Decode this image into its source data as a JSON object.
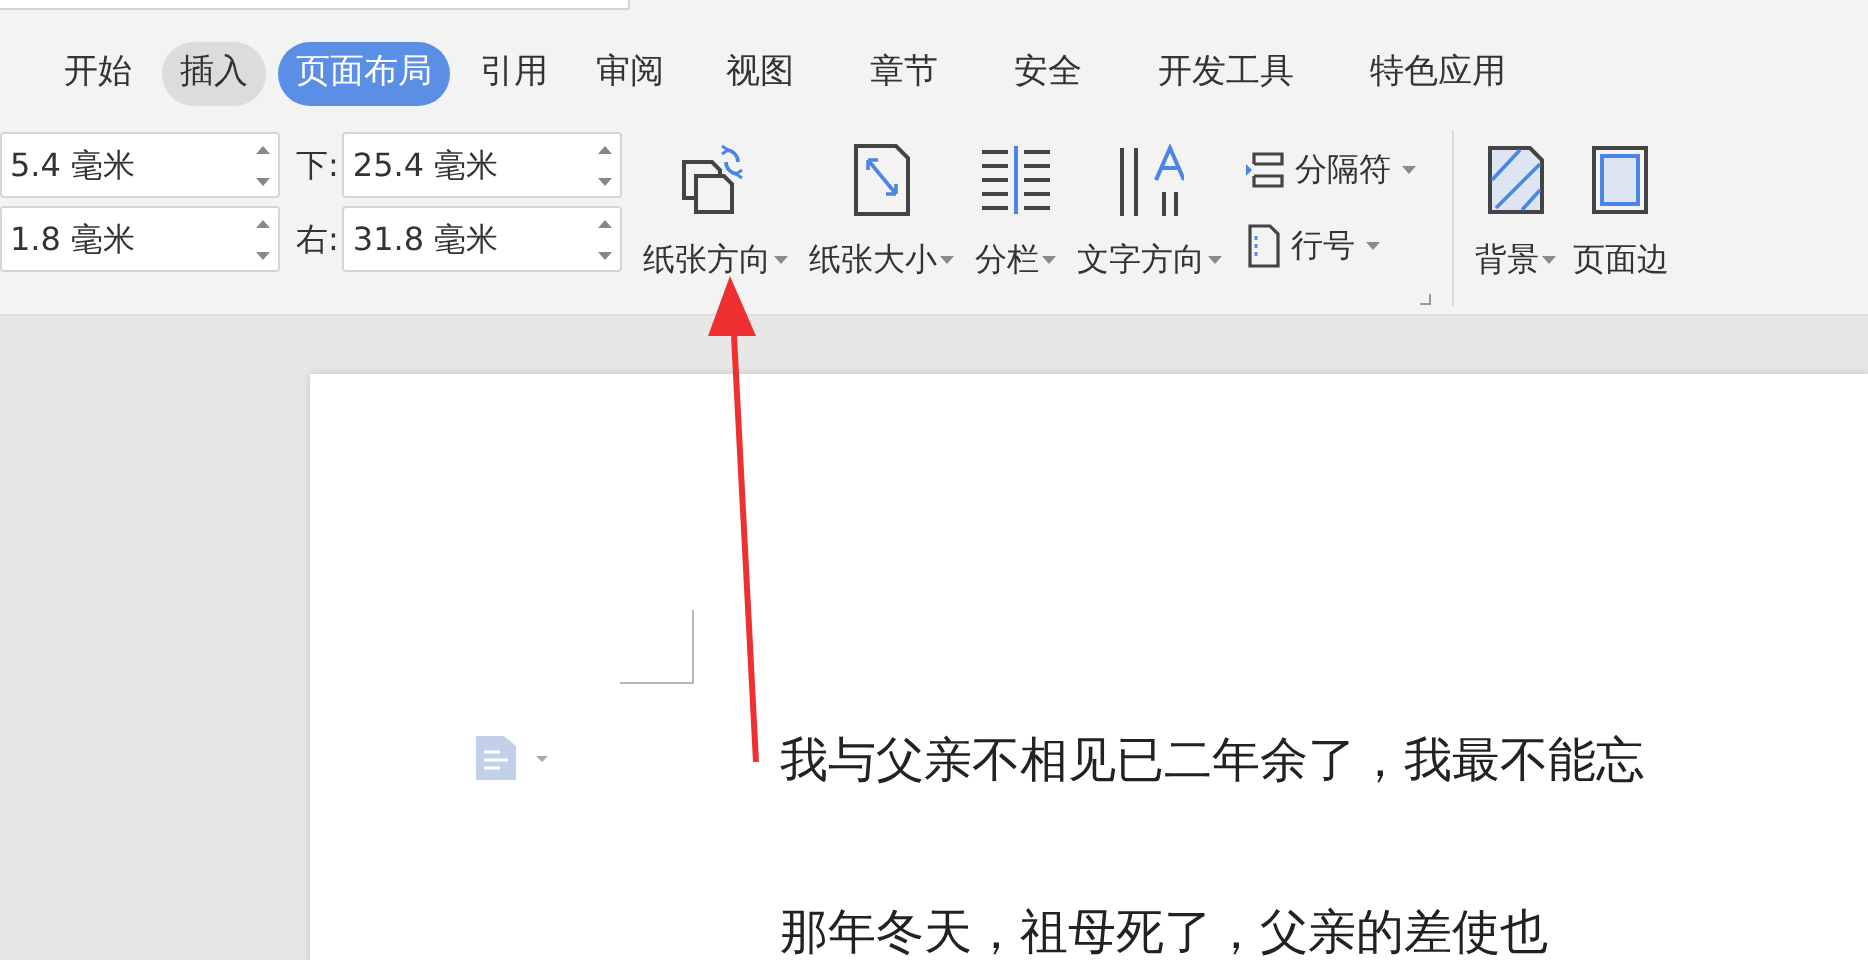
{
  "tabs": [
    {
      "label": "开始",
      "selected": false,
      "hovered": false
    },
    {
      "label": "插入",
      "selected": false,
      "hovered": true
    },
    {
      "label": "页面布局",
      "selected": true,
      "hovered": false
    },
    {
      "label": "引用",
      "selected": false,
      "hovered": false
    },
    {
      "label": "审阅",
      "selected": false,
      "hovered": false
    },
    {
      "label": "视图",
      "selected": false,
      "hovered": false
    },
    {
      "label": "章节",
      "selected": false,
      "hovered": false
    },
    {
      "label": "安全",
      "selected": false,
      "hovered": false
    },
    {
      "label": "开发工具",
      "selected": false,
      "hovered": false
    },
    {
      "label": "特色应用",
      "selected": false,
      "hovered": false
    }
  ],
  "margin_columns": [
    [
      {
        "value": "5.4 毫米"
      },
      {
        "value": "1.8 毫米"
      }
    ],
    [
      {
        "label": "下:",
        "value": "25.4 毫米"
      },
      {
        "label": "右:",
        "value": "31.8 毫米"
      }
    ]
  ],
  "big_buttons": [
    {
      "kind": "orientation",
      "label": "纸张方向"
    },
    {
      "kind": "size",
      "label": "纸张大小"
    },
    {
      "kind": "columns",
      "label": "分栏"
    },
    {
      "kind": "text-direction",
      "label": "文字方向"
    }
  ],
  "small_buttons": [
    {
      "kind": "break",
      "label": "分隔符"
    },
    {
      "kind": "line-numbers",
      "label": "行号"
    }
  ],
  "right_buttons": [
    {
      "kind": "background",
      "label": "背景",
      "caret": true
    },
    {
      "kind": "border",
      "label": "页面边",
      "caret": false
    }
  ],
  "document": {
    "paragraphs": [
      "我与父亲不相见已二年余了，我最不能忘",
      "那年冬天，祖母死了，父亲的差使也"
    ]
  }
}
